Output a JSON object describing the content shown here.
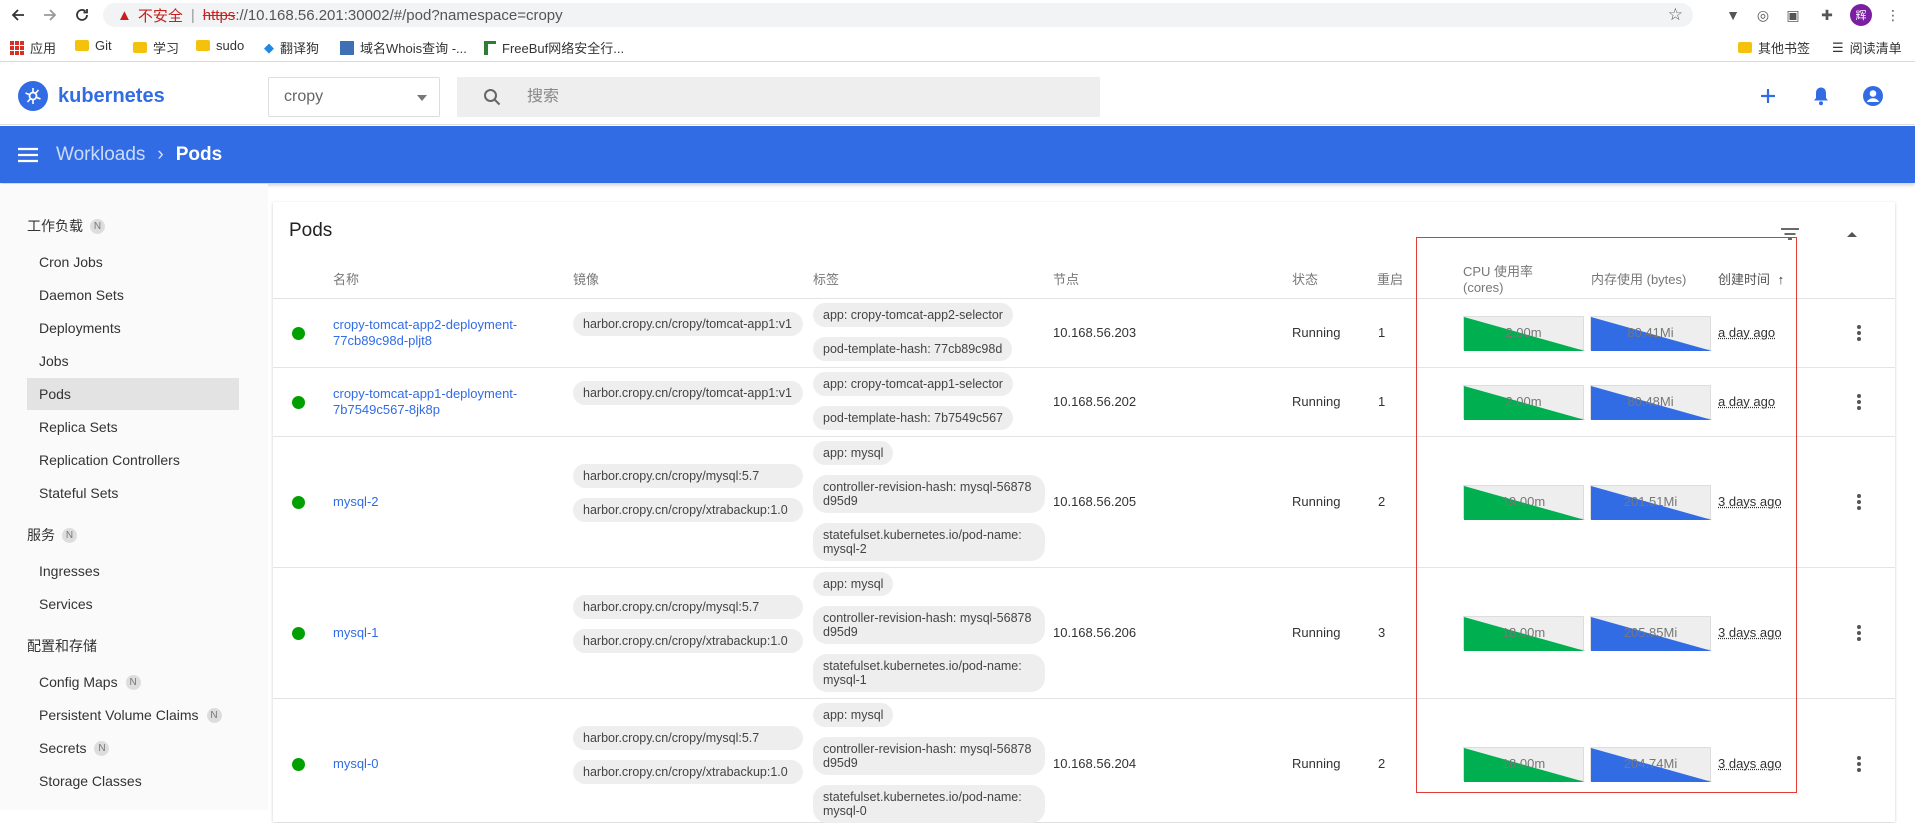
{
  "browser": {
    "insecure_label": "不安全",
    "url_scheme": "https",
    "url_rest": "://10.168.56.201:30002/#/pod?namespace=cropy",
    "profile_initial": "辉",
    "bookmarks": [
      {
        "label": "应用",
        "icon": "apps-grid-icon"
      },
      {
        "label": "Git",
        "icon": "folder-icon"
      },
      {
        "label": "学习",
        "icon": "folder-icon"
      },
      {
        "label": "sudo",
        "icon": "folder-icon"
      },
      {
        "label": "翻译狗",
        "icon": "translate-icon"
      },
      {
        "label": "域名Whois查询 -...",
        "icon": "whois-icon"
      },
      {
        "label": "FreeBuf网络安全行...",
        "icon": "freebuf-icon"
      }
    ],
    "bookmarks_right": [
      {
        "label": "其他书签",
        "icon": "folder-icon"
      },
      {
        "label": "阅读清单",
        "icon": "reading-list-icon"
      }
    ]
  },
  "header": {
    "logo_text": "kubernetes",
    "namespace": "cropy",
    "search_placeholder": "搜索"
  },
  "toolbar": {
    "crumb_parent": "Workloads",
    "crumb_current": "Pods"
  },
  "sidebar": {
    "sections": [
      {
        "label": "工作负载",
        "badge": "N"
      },
      {
        "label": "服务",
        "badge": "N"
      },
      {
        "label": "配置和存储",
        "badge": ""
      }
    ],
    "items": [
      {
        "label": "Cron Jobs",
        "badge": ""
      },
      {
        "label": "Daemon Sets",
        "badge": ""
      },
      {
        "label": "Deployments",
        "badge": ""
      },
      {
        "label": "Jobs",
        "badge": ""
      },
      {
        "label": "Pods",
        "badge": ""
      },
      {
        "label": "Replica Sets",
        "badge": ""
      },
      {
        "label": "Replication Controllers",
        "badge": ""
      },
      {
        "label": "Stateful Sets",
        "badge": ""
      },
      {
        "label": "Ingresses",
        "badge": ""
      },
      {
        "label": "Services",
        "badge": ""
      },
      {
        "label": "Config Maps",
        "badge": "N"
      },
      {
        "label": "Persistent Volume Claims",
        "badge": "N"
      },
      {
        "label": "Secrets",
        "badge": "N"
      },
      {
        "label": "Storage Classes",
        "badge": ""
      }
    ]
  },
  "pods": {
    "title": "Pods",
    "columns": {
      "name": "名称",
      "image": "镜像",
      "labels": "标签",
      "node": "节点",
      "status": "状态",
      "restarts": "重启",
      "cpu_line1": "CPU 使用率",
      "cpu_line2": "(cores)",
      "memory": "内存使用 (bytes)",
      "created": "创建时间",
      "sort_arrow": "↑"
    },
    "status_color": "#00a000",
    "rows": [
      {
        "name": "cropy-tomcat-app2-deployment-77cb89c98d-pljt8",
        "images": [
          "harbor.cropy.cn/cropy/tomcat-app1:v1"
        ],
        "labels": [
          "app: cropy-tomcat-app2-selector",
          "pod-template-hash: 77cb89c98d"
        ],
        "node": "10.168.56.203",
        "status": "Running",
        "restarts": "1",
        "cpu": "2.00m",
        "memory": "80.41Mi",
        "created": "a day ago"
      },
      {
        "name": "cropy-tomcat-app1-deployment-7b7549c567-8jk8p",
        "images": [
          "harbor.cropy.cn/cropy/tomcat-app1:v1"
        ],
        "labels": [
          "app: cropy-tomcat-app1-selector",
          "pod-template-hash: 7b7549c567"
        ],
        "node": "10.168.56.202",
        "status": "Running",
        "restarts": "1",
        "cpu": "2.00m",
        "memory": "80.48Mi",
        "created": "a day ago"
      },
      {
        "name": "mysql-2",
        "images": [
          "harbor.cropy.cn/cropy/mysql:5.7",
          "harbor.cropy.cn/cropy/xtrabackup:1.0"
        ],
        "labels": [
          "app: mysql",
          "controller-revision-hash: mysql-56878d95d9",
          "statefulset.kubernetes.io/pod-name: mysql-2"
        ],
        "node": "10.168.56.205",
        "status": "Running",
        "restarts": "2",
        "cpu": "19.00m",
        "memory": "201.51Mi",
        "created": "3 days ago"
      },
      {
        "name": "mysql-1",
        "images": [
          "harbor.cropy.cn/cropy/mysql:5.7",
          "harbor.cropy.cn/cropy/xtrabackup:1.0"
        ],
        "labels": [
          "app: mysql",
          "controller-revision-hash: mysql-56878d95d9",
          "statefulset.kubernetes.io/pod-name: mysql-1"
        ],
        "node": "10.168.56.206",
        "status": "Running",
        "restarts": "3",
        "cpu": "18.00m",
        "memory": "205.85Mi",
        "created": "3 days ago"
      },
      {
        "name": "mysql-0",
        "images": [
          "harbor.cropy.cn/cropy/mysql:5.7",
          "harbor.cropy.cn/cropy/xtrabackup:1.0"
        ],
        "labels": [
          "app: mysql",
          "controller-revision-hash: mysql-56878d95d9",
          "statefulset.kubernetes.io/pod-name: mysql-0"
        ],
        "node": "10.168.56.204",
        "status": "Running",
        "restarts": "2",
        "cpu": "18.00m",
        "memory": "204.74Mi",
        "created": "3 days ago"
      }
    ]
  },
  "colors": {
    "brand": "#326ce5",
    "cpu_spark": "#00b050",
    "memory_spark": "#326ce5",
    "highlight_box": "#e53935"
  }
}
